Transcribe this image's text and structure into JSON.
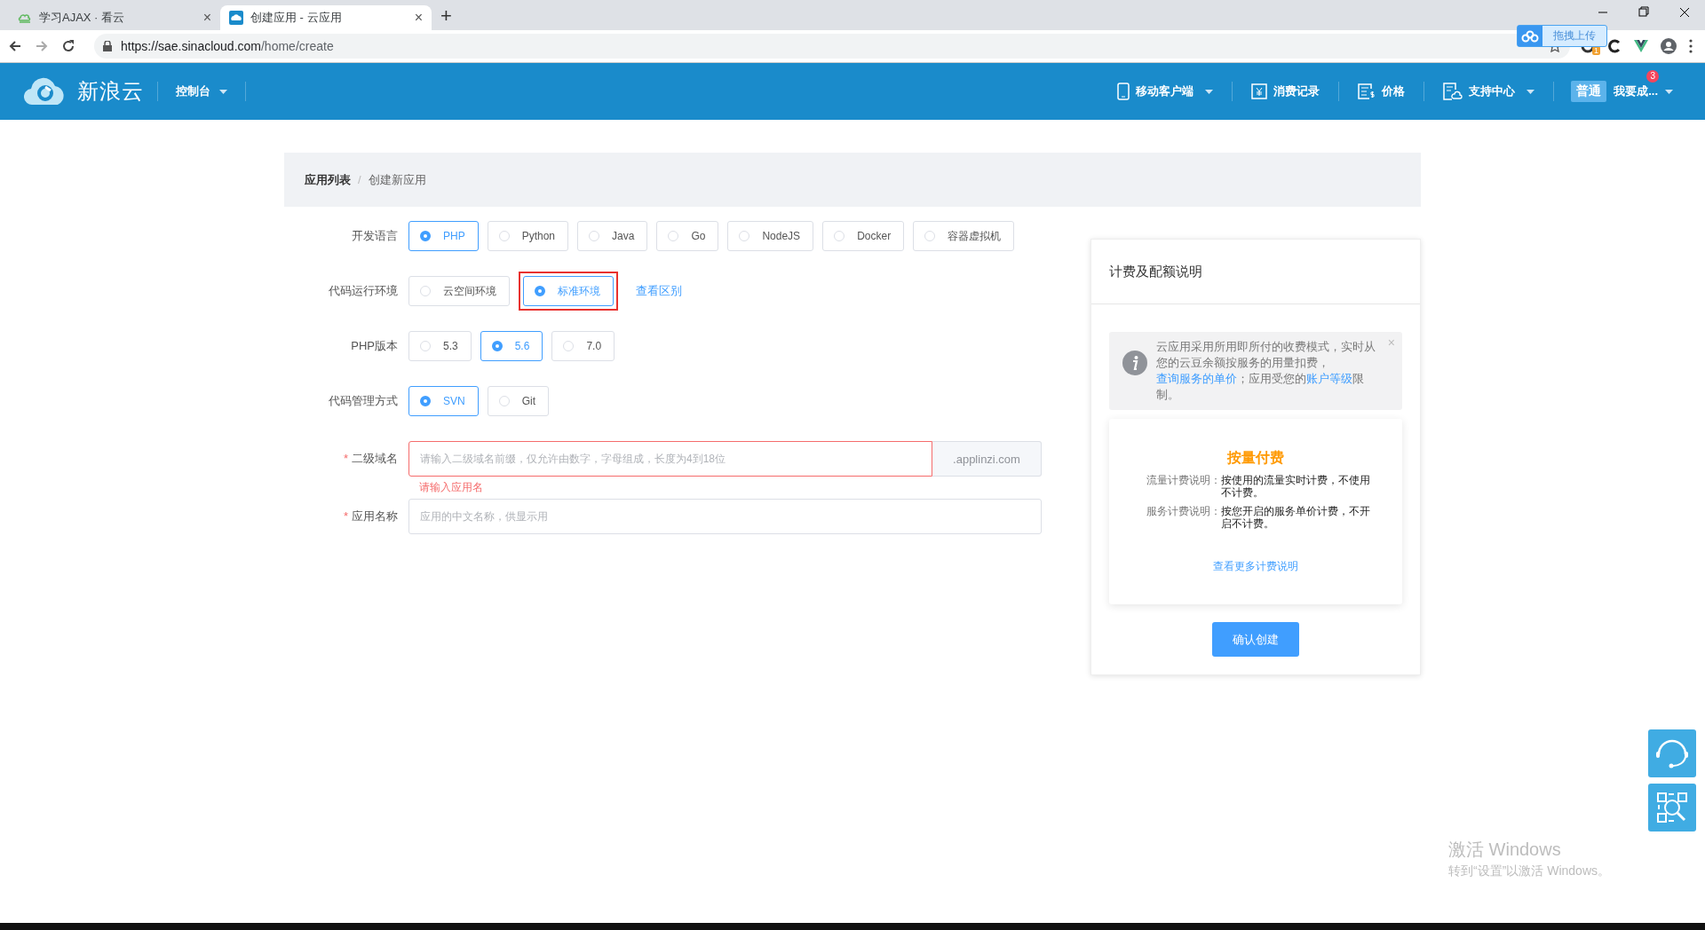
{
  "browser": {
    "tabs": [
      {
        "title": "学习AJAX · 看云",
        "selected": false,
        "close": "×"
      },
      {
        "title": "创建应用 - 云应用",
        "selected": true,
        "close": "×"
      }
    ],
    "new_tab": "+",
    "url_host": "https://sae.sinacloud.com",
    "url_path": "/home/create",
    "upload_popup": "拖拽上传",
    "extension_badge": "1"
  },
  "header": {
    "logo_text": "新浪云",
    "console_menu": "控制台",
    "nav": [
      {
        "label": "移动客户端",
        "kind": "phone",
        "dropdown": true
      },
      {
        "label": "消费记录",
        "kind": "receipt",
        "dropdown": false
      },
      {
        "label": "价格",
        "kind": "price",
        "dropdown": false
      },
      {
        "label": "支持中心",
        "kind": "support",
        "dropdown": true
      }
    ],
    "account_level": "普通",
    "user": "我要成...",
    "notification_count": "3"
  },
  "breadcrumb": {
    "items": [
      {
        "label": "应用列表",
        "current": false
      },
      {
        "label": "创建新应用",
        "current": true
      }
    ],
    "separator": "/"
  },
  "form": {
    "choice_rows": [
      {
        "label": "开发语言",
        "options": [
          {
            "label": "PHP",
            "selected": true
          },
          {
            "label": "Python",
            "selected": false
          },
          {
            "label": "Java",
            "selected": false
          },
          {
            "label": "Go",
            "selected": false
          },
          {
            "label": "NodeJS",
            "selected": false
          },
          {
            "label": "Docker",
            "selected": false
          },
          {
            "label": "容器虚拟机",
            "selected": false
          }
        ]
      },
      {
        "label": "代码运行环境",
        "options": [
          {
            "label": "云空间环境",
            "selected": false,
            "highlighted": false
          },
          {
            "label": "标准环境",
            "selected": true,
            "highlighted": true
          }
        ],
        "link": "查看区别"
      },
      {
        "label": "PHP版本",
        "options": [
          {
            "label": "5.3",
            "selected": false
          },
          {
            "label": "5.6",
            "selected": true
          },
          {
            "label": "7.0",
            "selected": false
          }
        ]
      },
      {
        "label": "代码管理方式",
        "options": [
          {
            "label": "SVN",
            "selected": true
          },
          {
            "label": "Git",
            "selected": false
          }
        ]
      }
    ],
    "fields": [
      {
        "required_mark": "*",
        "label": "二级域名",
        "placeholder": "请输入二级域名前缀，仅允许由数字，字母组成，长度为4到18位",
        "suffix": ".applinzi.com",
        "error": "请输入应用名"
      },
      {
        "required_mark": "*",
        "label": "应用名称",
        "placeholder": "应用的中文名称，供显示用"
      }
    ]
  },
  "billing": {
    "title": "计费及配额说明",
    "notice": {
      "segments": [
        {
          "kind": "text",
          "text": "云应用采用所用即所付的收费模式，实时从您的云豆余额按服务的用量扣费，"
        },
        {
          "kind": "link",
          "text": "查询服务的单价"
        },
        {
          "kind": "text",
          "text": "；应用受您的"
        },
        {
          "kind": "link",
          "text": "账户等级"
        },
        {
          "kind": "text",
          "text": "限制。"
        }
      ],
      "close": "×"
    },
    "plan": {
      "title": "按量付费",
      "items": [
        {
          "term": "流量计费说明：",
          "desc": "按使用的流量实时计费，不使用不计费。"
        },
        {
          "term": "服务计费说明：",
          "desc": "按您开启的服务单价计费，不开启不计费。"
        }
      ],
      "more_link": "查看更多计费说明"
    },
    "submit": "确认创建"
  },
  "activation": {
    "title": "激活 Windows",
    "subtitle": "转到“设置”以激活 Windows。"
  }
}
